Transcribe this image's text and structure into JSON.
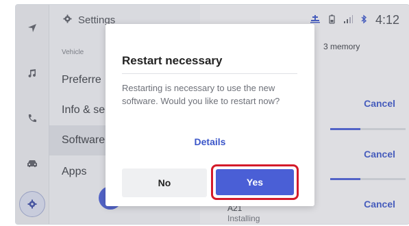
{
  "rail": {
    "icons": [
      "navigation-arrow-icon",
      "music-note-icon",
      "phone-icon",
      "car-icon",
      "settings-gear-icon"
    ]
  },
  "settings_panel": {
    "title": "Settings",
    "section_label": "Vehicle",
    "items": [
      {
        "label": "Preferre",
        "selected": false
      },
      {
        "label": "Info & se",
        "selected": false
      },
      {
        "label": "Software",
        "selected": true
      },
      {
        "label": "Apps",
        "selected": false
      }
    ]
  },
  "status_bar": {
    "time": "4:12"
  },
  "content": {
    "memory_text": "3 memory",
    "cancel_labels": [
      "Cancel",
      "Cancel",
      "Cancel"
    ],
    "row_title": "A21",
    "row_status": "Installing"
  },
  "dialog": {
    "title": "Restart necessary",
    "message": "Restarting is necessary to use the new software. Would you like to restart now?",
    "details_label": "Details",
    "no_label": "No",
    "yes_label": "Yes"
  },
  "colors": {
    "accent": "#4a5fd6",
    "link": "#3b56c9",
    "highlight": "#d41a2a"
  }
}
